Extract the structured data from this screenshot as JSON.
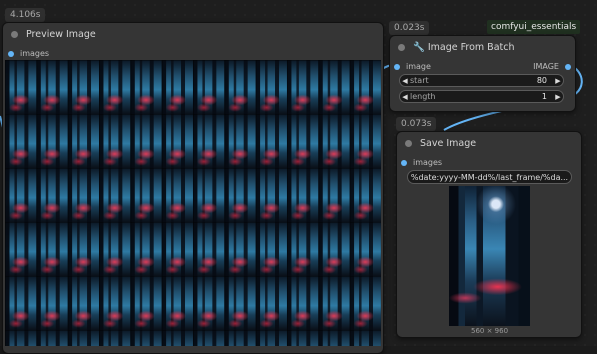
{
  "badges": {
    "preview_time": "4.106s",
    "batch_time": "0.023s",
    "save_time": "0.073s",
    "extension": "comfyui_essentials"
  },
  "preview_node": {
    "title": "Preview Image",
    "input_label": "images"
  },
  "batch_node": {
    "title": "🔧 Image From Batch",
    "input_label": "image",
    "output_label": "IMAGE",
    "widgets": [
      {
        "label": "start",
        "value": "80"
      },
      {
        "label": "length",
        "value": "1"
      }
    ]
  },
  "save_node": {
    "title": "Save Image",
    "input_label": "images",
    "filename_prefix": "%date:yyyy-MM-dd%/last_frame/%da...",
    "image_size": "560 × 960"
  },
  "colors": {
    "link": "#64b5f6",
    "node_bg": "#353535"
  }
}
